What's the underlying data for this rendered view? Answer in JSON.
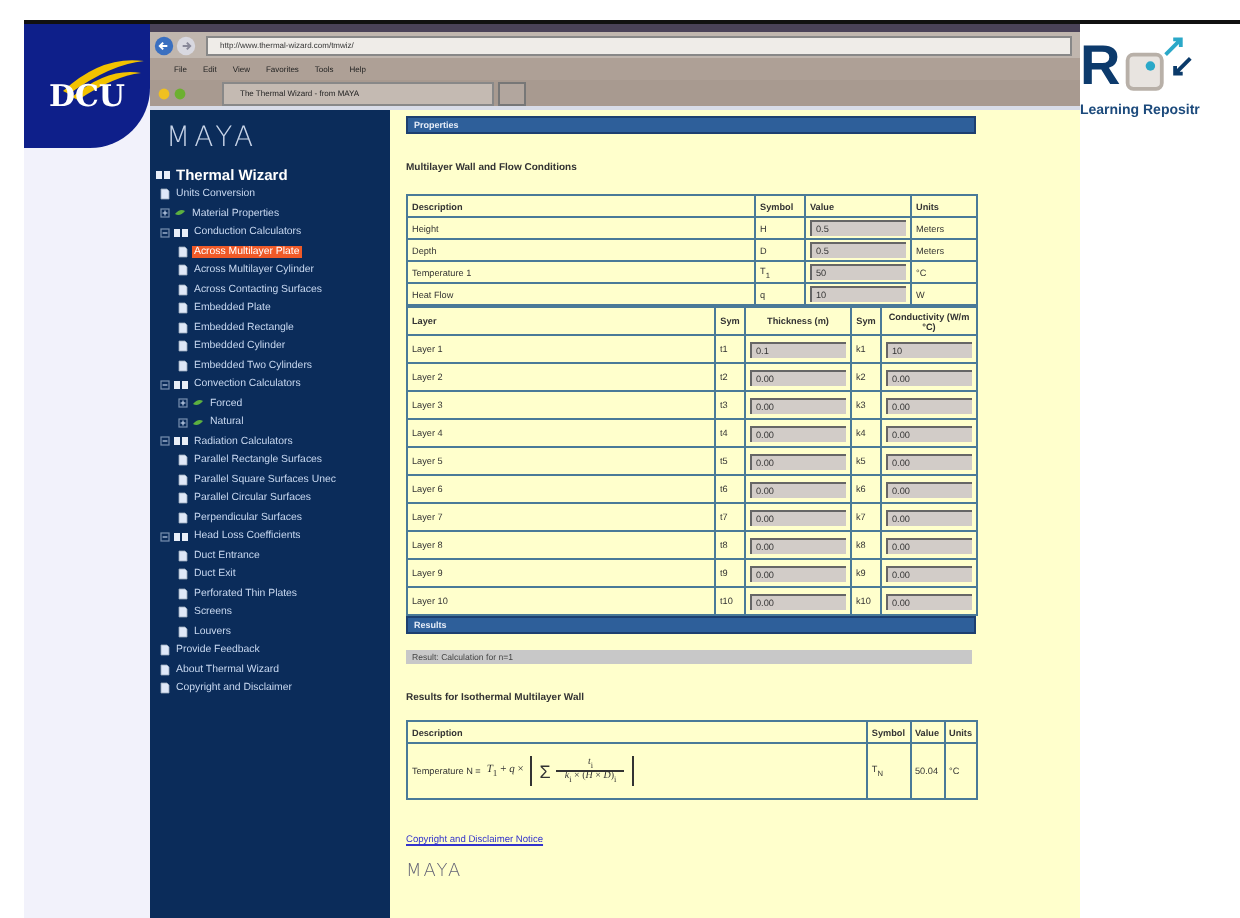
{
  "slide": {
    "logo": "DCU",
    "brand_mark": "R",
    "brand_text": "Learning Repositr"
  },
  "browser": {
    "address": "http://www.thermal-wizard.com/tmwiz/",
    "menu": [
      "File",
      "Edit",
      "View",
      "Favorites",
      "Tools",
      "Help"
    ],
    "tab": "The Thermal Wizard - from MAYA"
  },
  "sidebar": {
    "logo": "MAYA",
    "tree": [
      {
        "label": "Thermal Wizard",
        "kind": "folder",
        "expanded": true,
        "selected": false,
        "children": [
          {
            "label": "Units Conversion",
            "kind": "page",
            "selected": false
          },
          {
            "label": "Material Properties",
            "kind": "folder",
            "expanded": false,
            "selected": false
          },
          {
            "label": "Conduction Calculators",
            "kind": "folder",
            "expanded": true,
            "selected": false,
            "children": [
              {
                "label": "Across Multilayer Plate",
                "kind": "page",
                "selected": true
              },
              {
                "label": "Across Multilayer Cylinder",
                "kind": "page",
                "selected": false
              },
              {
                "label": "Across Contacting Surfaces",
                "kind": "page",
                "selected": false
              },
              {
                "label": "Embedded Plate",
                "kind": "page",
                "selected": false
              },
              {
                "label": "Embedded Rectangle",
                "kind": "page",
                "selected": false
              },
              {
                "label": "Embedded Cylinder",
                "kind": "page",
                "selected": false
              },
              {
                "label": "Embedded Two Cylinders",
                "kind": "page",
                "selected": false
              }
            ]
          },
          {
            "label": "Convection Calculators",
            "kind": "folder",
            "expanded": true,
            "selected": false,
            "children": [
              {
                "label": "Forced",
                "kind": "folder",
                "expanded": false,
                "selected": false
              },
              {
                "label": "Natural",
                "kind": "folder",
                "expanded": false,
                "selected": false
              }
            ]
          },
          {
            "label": "Radiation Calculators",
            "kind": "folder",
            "expanded": true,
            "selected": false,
            "children": [
              {
                "label": "Parallel Rectangle Surfaces",
                "kind": "page",
                "selected": false
              },
              {
                "label": "Parallel Square Surfaces Unec",
                "kind": "page",
                "selected": false
              },
              {
                "label": "Parallel Circular Surfaces",
                "kind": "page",
                "selected": false
              },
              {
                "label": "Perpendicular Surfaces",
                "kind": "page",
                "selected": false
              }
            ]
          },
          {
            "label": "Head Loss Coefficients",
            "kind": "folder",
            "expanded": true,
            "selected": false,
            "children": [
              {
                "label": "Duct Entrance",
                "kind": "page",
                "selected": false
              },
              {
                "label": "Duct Exit",
                "kind": "page",
                "selected": false
              },
              {
                "label": "Perforated Thin Plates",
                "kind": "page",
                "selected": false
              },
              {
                "label": "Screens",
                "kind": "page",
                "selected": false
              },
              {
                "label": "Louvers",
                "kind": "page",
                "selected": false
              }
            ]
          },
          {
            "label": "Provide Feedback",
            "kind": "page",
            "selected": false
          },
          {
            "label": "About Thermal Wizard",
            "kind": "page",
            "selected": false
          },
          {
            "label": "Copyright and Disclaimer",
            "kind": "page",
            "selected": false
          }
        ]
      }
    ]
  },
  "main": {
    "section_bar": "Properties",
    "conditions": {
      "title": "Multilayer Wall and Flow Conditions",
      "columns": [
        "Description",
        "Symbol",
        "Value",
        "Units"
      ],
      "rows": [
        {
          "description": "Height",
          "symbol": "H",
          "value": "0.5",
          "units": "Meters"
        },
        {
          "description": "Depth",
          "symbol": "D",
          "value": "0.5",
          "units": "Meters"
        },
        {
          "description": "Temperature 1",
          "symbol": "T$_{1}$",
          "value": "50",
          "units": "°C"
        },
        {
          "description": "Heat Flow",
          "symbol": "q",
          "value": "10",
          "units": "W"
        }
      ]
    },
    "layers": {
      "columns": [
        "Layer",
        "Sym",
        "Thickness (m)",
        "Sym",
        "Conductivity (W/m °C)"
      ],
      "rows": [
        {
          "layer": "Layer 1",
          "thickness_symbol": "t1",
          "thickness": "0.1",
          "conductivity_symbol": "k1",
          "conductivity": "10"
        },
        {
          "layer": "Layer 2",
          "thickness_symbol": "t2",
          "thickness": "0.00",
          "conductivity_symbol": "k2",
          "conductivity": "0.00"
        },
        {
          "layer": "Layer 3",
          "thickness_symbol": "t3",
          "thickness": "0.00",
          "conductivity_symbol": "k3",
          "conductivity": "0.00"
        },
        {
          "layer": "Layer 4",
          "thickness_symbol": "t4",
          "thickness": "0.00",
          "conductivity_symbol": "k4",
          "conductivity": "0.00"
        },
        {
          "layer": "Layer 5",
          "thickness_symbol": "t5",
          "thickness": "0.00",
          "conductivity_symbol": "k5",
          "conductivity": "0.00"
        },
        {
          "layer": "Layer 6",
          "thickness_symbol": "t6",
          "thickness": "0.00",
          "conductivity_symbol": "k6",
          "conductivity": "0.00"
        },
        {
          "layer": "Layer 7",
          "thickness_symbol": "t7",
          "thickness": "0.00",
          "conductivity_symbol": "k7",
          "conductivity": "0.00"
        },
        {
          "layer": "Layer 8",
          "thickness_symbol": "t8",
          "thickness": "0.00",
          "conductivity_symbol": "k8",
          "conductivity": "0.00"
        },
        {
          "layer": "Layer 9",
          "thickness_symbol": "t9",
          "thickness": "0.00",
          "conductivity_symbol": "k9",
          "conductivity": "0.00"
        },
        {
          "layer": "Layer 10",
          "thickness_symbol": "t10",
          "thickness": "0.00",
          "conductivity_symbol": "k10",
          "conductivity": "0.00"
        }
      ]
    },
    "results_bar": "Results",
    "result_message": "Result: Calculation for n=1",
    "results": {
      "title": "Results for Isothermal Multilayer Wall",
      "columns": [
        "Description",
        "Symbol",
        "Value",
        "Units"
      ],
      "rows": [
        {
          "description": "Temperature N =",
          "formula_lead": "*T*$_{1}$ + *q* ×",
          "sigma": "Σ",
          "numerator": "*t*$_{i}$",
          "denominator": "*k*$_{i}$ × (*H* × *D*)$_{i}$",
          "symbol": "T$_{N}$",
          "value": "50.04",
          "units": "°C"
        }
      ]
    },
    "link": "Copyright and Disclaimer Notice",
    "footer_logo": "MAYA"
  }
}
